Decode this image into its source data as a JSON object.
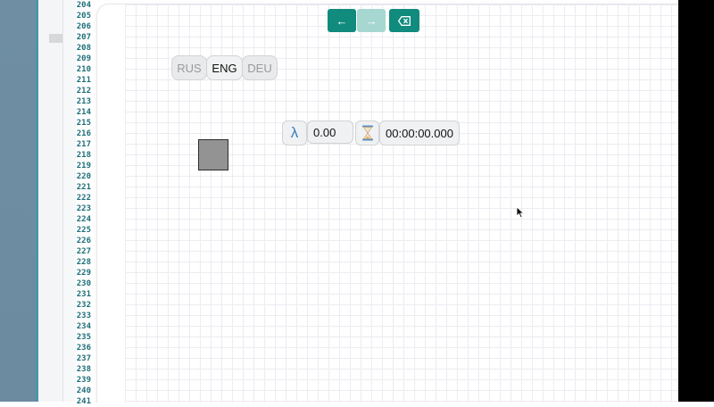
{
  "editor": {
    "line_numbers": [
      "204",
      "205",
      "206",
      "207",
      "208",
      "209",
      "210",
      "211",
      "212",
      "213",
      "214",
      "215",
      "216",
      "217",
      "218",
      "219",
      "220",
      "221",
      "222",
      "223",
      "224",
      "225",
      "226",
      "227",
      "228",
      "229",
      "230",
      "231",
      "232",
      "233",
      "234",
      "235",
      "236",
      "237",
      "238",
      "239",
      "240",
      "241"
    ]
  },
  "toolbar": {
    "back_label": "←",
    "forward_label": "→",
    "clear_label": "⌫"
  },
  "languages": {
    "rus": "RUS",
    "eng": "ENG",
    "deu": "DEU",
    "active": "ENG"
  },
  "controls": {
    "lambda_symbol": "λ",
    "lambda_value": "0.00",
    "hourglass_symbol": "⏳",
    "timer_value": "00:00:00.000"
  },
  "colors": {
    "accent": "#108b7e",
    "accent_disabled": "#a6d7d1",
    "square_fill": "#939393"
  }
}
